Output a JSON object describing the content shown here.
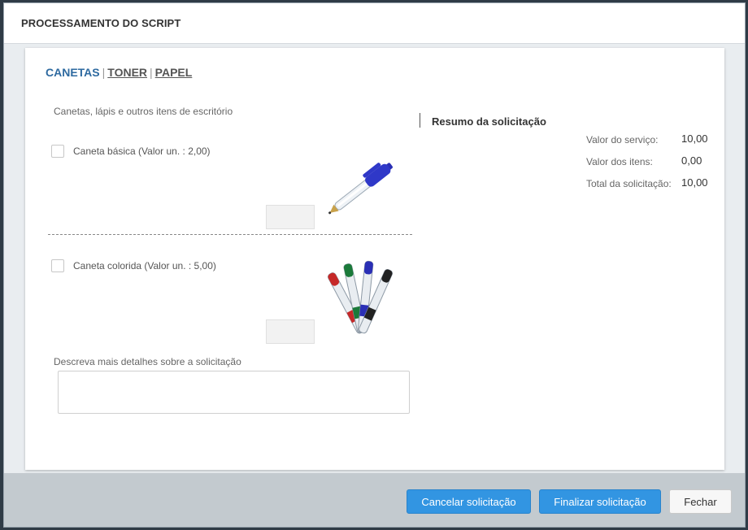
{
  "dialog": {
    "title": "PROCESSAMENTO DO SCRIPT"
  },
  "tabs": [
    {
      "label": "CANETAS",
      "active": true
    },
    {
      "label": "TONER",
      "active": false
    },
    {
      "label": "PAPEL",
      "active": false
    }
  ],
  "tab_separator": "|",
  "form": {
    "section_label": "Canetas, lápis e outros itens de escritório",
    "items": [
      {
        "label": "Caneta básica (Valor un. : 2,00)",
        "checked": false,
        "quantity": "",
        "image_icon": "ballpoint-pen"
      },
      {
        "label": "Caneta colorida (Valor un. : 5,00)",
        "checked": false,
        "quantity": "",
        "image_icon": "colored-pens"
      }
    ],
    "details_label": "Descreva mais detalhes sobre a solicitação",
    "details_value": ""
  },
  "summary": {
    "title": "Resumo da solicitação",
    "rows": [
      {
        "label": "Valor do serviço:",
        "value": "10,00"
      },
      {
        "label": "Valor dos itens:",
        "value": "0,00"
      },
      {
        "label": "Total da solicitação:",
        "value": "10,00"
      }
    ]
  },
  "footer": {
    "cancel_label": "Cancelar solicitação",
    "finish_label": "Finalizar solicitação",
    "close_label": "Fechar"
  },
  "colors": {
    "accent": "#3295e2",
    "active_tab": "#2e6aa0",
    "pen_red": "#c62828",
    "pen_green": "#1b7a3a",
    "pen_blue": "#2a2fb5",
    "pen_black": "#222222"
  }
}
